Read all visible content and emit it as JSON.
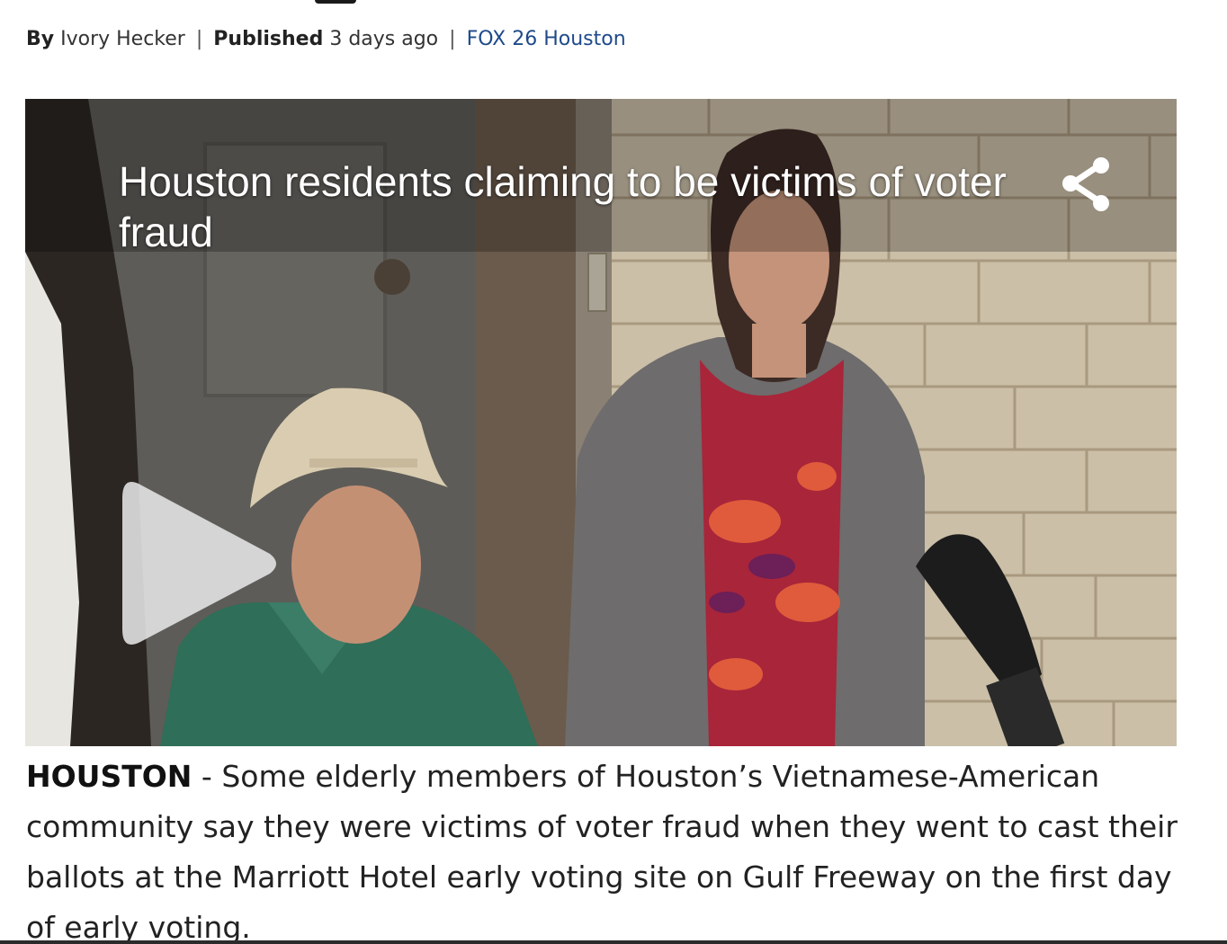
{
  "byline": {
    "by_label": "By",
    "author": "Ivory Hecker",
    "published_label": "Published",
    "published_time": "3 days ago",
    "source": "FOX 26 Houston"
  },
  "video": {
    "title": "Houston residents claiming to be victims of voter fraud",
    "share_icon": "share-icon",
    "play_icon": "play-icon"
  },
  "article": {
    "dateline": "HOUSTON",
    "separator": " - ",
    "lede": "Some elderly members of Houston’s Vietnamese-American community say they were victims of voter fraud when they went to cast their ballots at the Marriott Hotel early voting site on Gulf Freeway on the first day of early voting."
  },
  "colors": {
    "source_link": "#1f4a8a",
    "text": "#222222"
  }
}
